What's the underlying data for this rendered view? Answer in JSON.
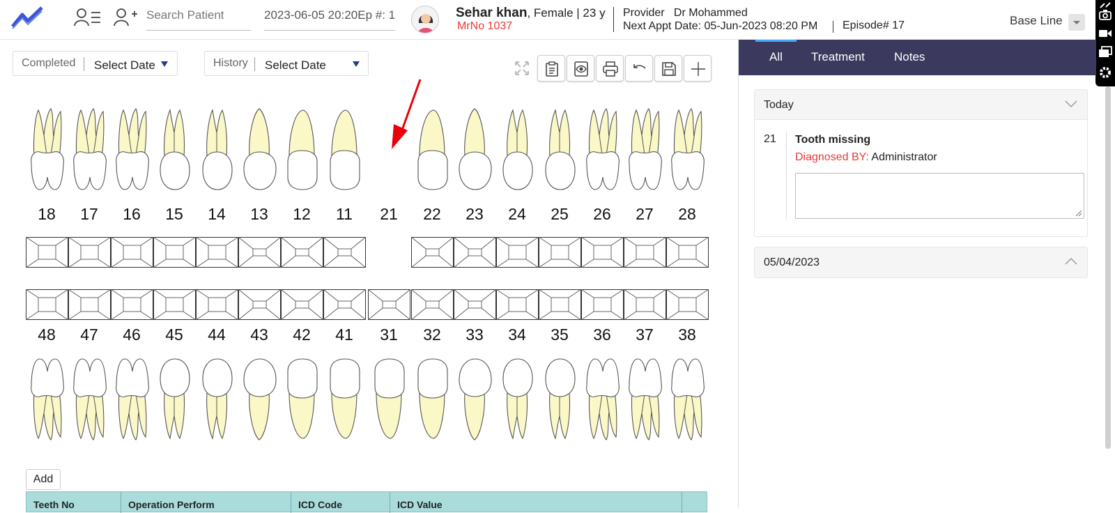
{
  "header": {
    "search_placeholder": "Search Patient",
    "episode_field": "2023-06-05 20:20Ep #: 1",
    "patient_name": "Sehar khan",
    "patient_info": ", Female | 23 y",
    "mrno": "MrNo 1037",
    "provider_label": "Provider",
    "provider_name": "Dr Mohammed",
    "next_appt_label": "Next Appt Date:",
    "next_appt_value": "05-Jun-2023 08:20 PM",
    "episode": "Episode# 17",
    "baseline": "Base Line"
  },
  "filters": {
    "completed_label": "Completed",
    "completed_value": "Select Date",
    "history_label": "History",
    "history_value": "Select Date"
  },
  "toolbar": {
    "icons": [
      "expand-icon",
      "clipboard-icon",
      "view-icon",
      "print-icon",
      "undo-icon",
      "save-icon",
      "add-icon"
    ]
  },
  "chart": {
    "upper_teeth": [
      "18",
      "17",
      "16",
      "15",
      "14",
      "13",
      "12",
      "11",
      "21",
      "22",
      "23",
      "24",
      "25",
      "26",
      "27",
      "28"
    ],
    "lower_teeth": [
      "48",
      "47",
      "46",
      "45",
      "44",
      "43",
      "42",
      "41",
      "31",
      "32",
      "33",
      "34",
      "35",
      "36",
      "37",
      "38"
    ],
    "missing_tooth": "21"
  },
  "table": {
    "add_label": "Add",
    "columns": [
      "Teeth No",
      "Operation Perform",
      "ICD Code",
      "ICD Value"
    ]
  },
  "right_panel": {
    "tabs": [
      "All",
      "Treatment",
      "Notes"
    ],
    "active_tab": "All",
    "today_label": "Today",
    "entry": {
      "tooth": "21",
      "title": "Tooth missing",
      "diagnosed_by_label": "Diagnosed BY:",
      "diagnosed_by_value": "Administrator"
    },
    "date_group": "05/04/2023"
  },
  "colors": {
    "accent": "#3b3a5e",
    "alert": "#e53935",
    "root": "#fbf8c8",
    "table_header": "#a9dcdb",
    "tab_indicator": "#3fa8ff"
  }
}
